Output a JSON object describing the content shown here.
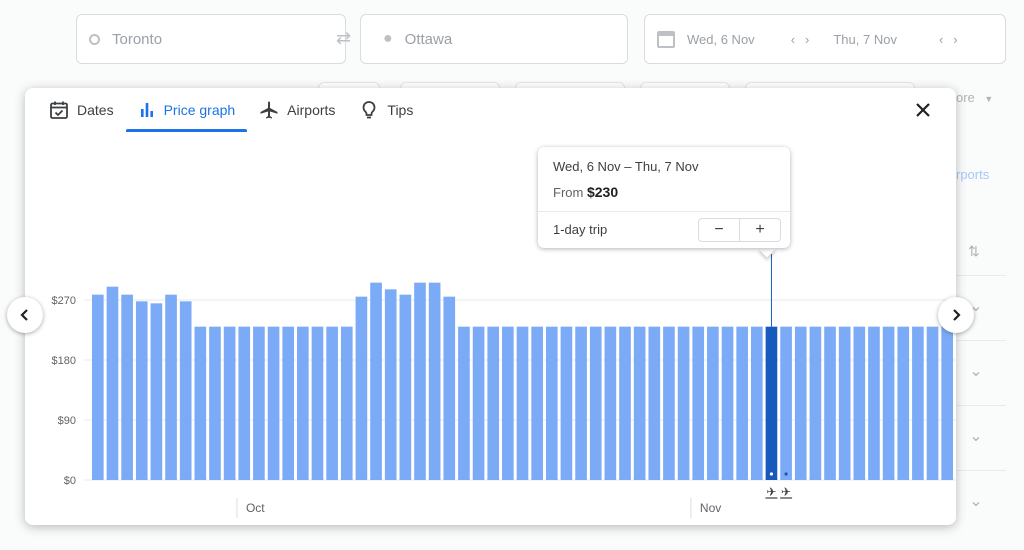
{
  "search": {
    "origin": "Toronto",
    "destination": "Ottawa",
    "depart_date": "Wed, 6 Nov",
    "return_date": "Thu, 7 Nov",
    "more_label": "ore",
    "airports_label": "rports"
  },
  "tabs": [
    {
      "label": "Dates",
      "icon": "calendar-check-icon"
    },
    {
      "label": "Price graph",
      "icon": "bar-chart-icon",
      "active": true
    },
    {
      "label": "Airports",
      "icon": "airplane-icon"
    },
    {
      "label": "Tips",
      "icon": "lightbulb-icon"
    }
  ],
  "popup": {
    "range": "Wed, 6 Nov – Thu, 7 Nov",
    "from_label": "From",
    "price": "$230",
    "trip_length": "1-day trip",
    "minus": "−",
    "plus": "+"
  },
  "colors": {
    "bar": "#7baaf7",
    "selected_bar": "#185abc",
    "accent": "#1a73e8"
  },
  "chart_data": {
    "type": "bar",
    "ylim": [
      0,
      270
    ],
    "yticks": [
      {
        "value": 0,
        "label": "$0"
      },
      {
        "value": 90,
        "label": "$90"
      },
      {
        "value": 180,
        "label": "$180"
      },
      {
        "value": 270,
        "label": "$270"
      }
    ],
    "x_markers": [
      {
        "label": "Oct",
        "after_index": 9
      },
      {
        "label": "Nov",
        "after_index": 40
      }
    ],
    "selected_index": 46,
    "values": [
      278,
      290,
      278,
      268,
      265,
      278,
      268,
      230,
      230,
      230,
      230,
      230,
      230,
      230,
      230,
      230,
      230,
      230,
      275,
      296,
      286,
      278,
      296,
      296,
      275,
      230,
      230,
      230,
      230,
      230,
      230,
      230,
      230,
      230,
      230,
      230,
      230,
      230,
      230,
      230,
      230,
      230,
      230,
      230,
      230,
      230,
      230,
      230,
      230,
      230,
      230,
      230,
      230,
      230,
      230,
      230,
      230,
      230,
      230
    ]
  }
}
